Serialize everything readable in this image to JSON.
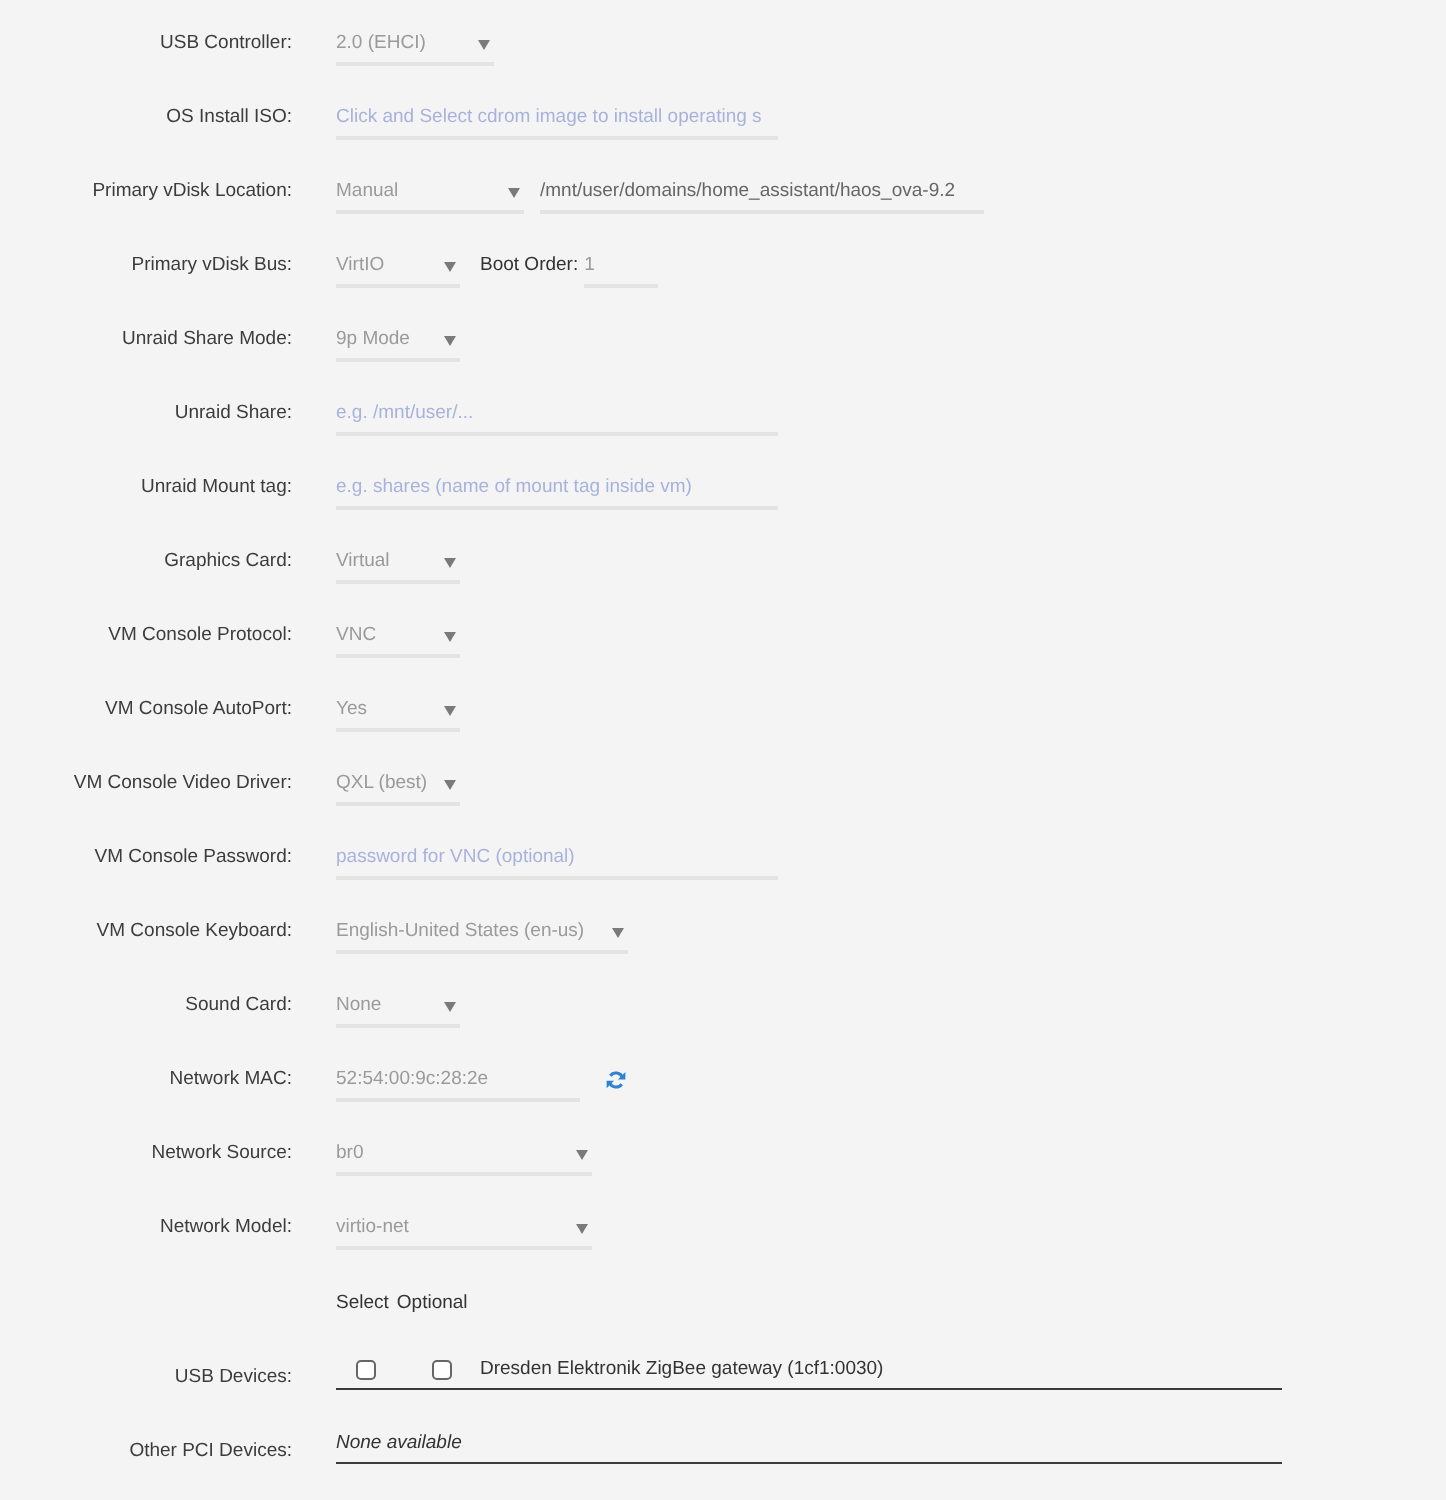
{
  "usb_controller": {
    "label": "USB Controller:",
    "value": "2.0 (EHCI)"
  },
  "os_install_iso": {
    "label": "OS Install ISO:",
    "placeholder": "Click and Select cdrom image to install operating s"
  },
  "primary_vdisk_location": {
    "label": "Primary vDisk Location:",
    "value": "Manual",
    "path": "/mnt/user/domains/home_assistant/haos_ova-9.2"
  },
  "primary_vdisk_bus": {
    "label": "Primary vDisk Bus:",
    "value": "VirtIO",
    "boot_order_label": "Boot Order:",
    "boot_order": "1"
  },
  "unraid_share_mode": {
    "label": "Unraid Share Mode:",
    "value": "9p Mode"
  },
  "unraid_share": {
    "label": "Unraid Share:",
    "placeholder": "e.g. /mnt/user/..."
  },
  "unraid_mount_tag": {
    "label": "Unraid Mount tag:",
    "placeholder": "e.g. shares (name of mount tag inside vm)"
  },
  "graphics_card": {
    "label": "Graphics Card:",
    "value": "Virtual"
  },
  "vm_console_protocol": {
    "label": "VM Console Protocol:",
    "value": "VNC"
  },
  "vm_console_autoport": {
    "label": "VM Console AutoPort:",
    "value": "Yes"
  },
  "vm_console_video_driver": {
    "label": "VM Console Video Driver:",
    "value": "QXL (best)"
  },
  "vm_console_password": {
    "label": "VM Console Password:",
    "placeholder": "password for VNC (optional)"
  },
  "vm_console_keyboard": {
    "label": "VM Console Keyboard:",
    "value": "English-United States (en-us)"
  },
  "sound_card": {
    "label": "Sound Card:",
    "value": "None"
  },
  "network_mac": {
    "label": "Network MAC:",
    "value": "52:54:00:9c:28:2e"
  },
  "network_source": {
    "label": "Network Source:",
    "value": "br0"
  },
  "network_model": {
    "label": "Network Model:",
    "value": "virtio-net"
  },
  "usb_devices": {
    "label": "USB Devices:",
    "columns": [
      "Select",
      "Optional"
    ],
    "devices": [
      {
        "name": "Dresden Elektronik ZigBee gateway (1cf1:0030)",
        "selected": false,
        "optional": false
      }
    ]
  },
  "other_pci_devices": {
    "label": "Other PCI Devices:",
    "value": "None available"
  }
}
